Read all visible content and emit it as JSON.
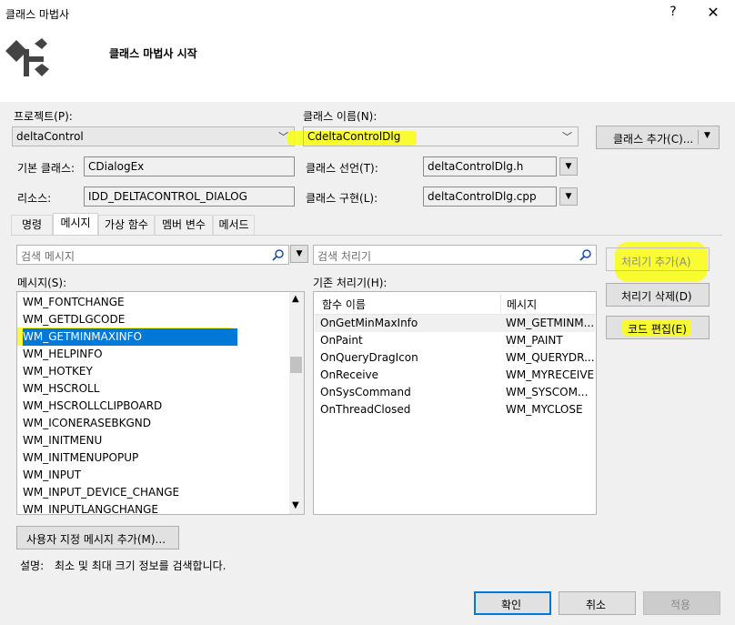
{
  "window": {
    "title": "클래스 마법사",
    "help": "?",
    "close": "✕",
    "header_title": "클래스 마법사 시작"
  },
  "project": {
    "label": "프로젝트(P):",
    "value": "deltaControl"
  },
  "class_name": {
    "label": "클래스 이름(N):",
    "value": "CdeltaControlDlg"
  },
  "add_class_button": {
    "label": "클래스 추가(C)..."
  },
  "base_class": {
    "label": "기본 클래스:",
    "value": "CDialogEx"
  },
  "resource": {
    "label": "리소스:",
    "value": "IDD_DELTACONTROL_DIALOG"
  },
  "class_decl": {
    "label": "클래스 선언(T):",
    "value": "deltaControlDlg.h"
  },
  "class_impl": {
    "label": "클래스 구현(L):",
    "value": "deltaControlDlg.cpp"
  },
  "tabs": [
    {
      "label": "명령"
    },
    {
      "label": "메시지"
    },
    {
      "label": "가상 함수"
    },
    {
      "label": "멤버 변수"
    },
    {
      "label": "메서드"
    }
  ],
  "message_search": {
    "placeholder": "검색 메시지"
  },
  "handler_search": {
    "placeholder": "검색 처리기"
  },
  "messages_label": "메시지(S):",
  "handlers_label": "기존 처리기(H):",
  "messages": [
    "WM_FONTCHANGE",
    "WM_GETDLGCODE",
    "WM_GETMINMAXINFO",
    "WM_HELPINFO",
    "WM_HOTKEY",
    "WM_HSCROLL",
    "WM_HSCROLLCLIPBOARD",
    "WM_ICONERASEBKGND",
    "WM_INITMENU",
    "WM_INITMENUPOPUP",
    "WM_INPUT",
    "WM_INPUT_DEVICE_CHANGE",
    "WM_INPUTLANGCHANGE"
  ],
  "handler_columns": {
    "function": "함수 이름",
    "message": "메시지"
  },
  "handlers": [
    {
      "function": "OnGetMinMaxInfo",
      "message": "WM_GETMINM..."
    },
    {
      "function": "OnPaint",
      "message": "WM_PAINT"
    },
    {
      "function": "OnQueryDragIcon",
      "message": "WM_QUERYDR..."
    },
    {
      "function": "OnReceive",
      "message": "WM_MYRECEIVE"
    },
    {
      "function": "OnSysCommand",
      "message": "WM_SYSCOM..."
    },
    {
      "function": "OnThreadClosed",
      "message": "WM_MYCLOSE"
    }
  ],
  "buttons": {
    "add_handler": "처리기 추가(A)",
    "delete_handler": "처리기 삭제(D)",
    "edit_code": "코드 편집(E)",
    "add_custom_message": "사용자 지정 메시지 추가(M)...",
    "ok": "확인",
    "cancel": "취소",
    "apply": "적용"
  },
  "description": {
    "label": "설명:",
    "text": "최소 및 최대 크기 정보를 검색합니다."
  },
  "colors": {
    "selection": "#0078d7",
    "highlight": "#f9fc1e",
    "body": "#f0f0f0"
  }
}
